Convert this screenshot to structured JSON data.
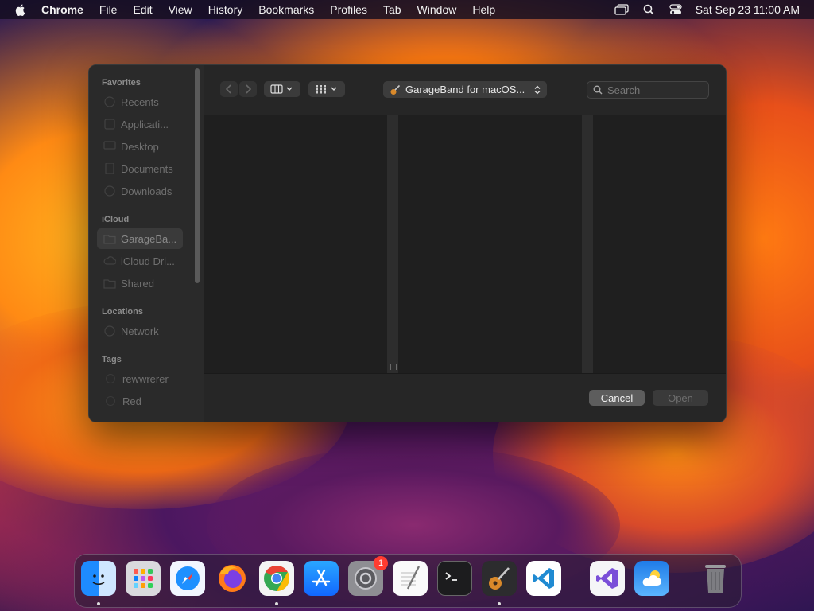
{
  "menubar": {
    "app_name": "Chrome",
    "items": [
      "File",
      "Edit",
      "View",
      "History",
      "Bookmarks",
      "Profiles",
      "Tab",
      "Window",
      "Help"
    ],
    "clock": "Sat Sep 23  11:00 AM",
    "status_icons": [
      "screen-mirroring-icon",
      "search-icon",
      "control-center-icon"
    ]
  },
  "dialog": {
    "sidebar": {
      "sections": [
        {
          "label": "Favorites",
          "items": [
            "Recents",
            "Applicati...",
            "Desktop",
            "Documents",
            "Downloads"
          ]
        },
        {
          "label": "iCloud",
          "items": [
            "GarageBa...",
            "iCloud Dri...",
            "Shared"
          ]
        },
        {
          "label": "Locations",
          "items": [
            "Network"
          ]
        },
        {
          "label": "Tags",
          "items": [
            "rewwrerer",
            "Red"
          ]
        }
      ],
      "selected": "GarageBa...",
      "tag_colors": {
        "rewwrerer": "#2a2a2a",
        "Red": "#2a2a2a"
      }
    },
    "toolbar": {
      "location": "GarageBand for macOS...",
      "search_placeholder": "Search"
    },
    "buttons": {
      "cancel": "Cancel",
      "open": "Open"
    }
  },
  "dock": {
    "apps": [
      "Finder",
      "Launchpad",
      "Safari",
      "Firefox",
      "Chrome",
      "App Store",
      "System Settings",
      "TextEdit",
      "Terminal",
      "GarageBand",
      "Visual Studio Code",
      "Visual Studio",
      "Weather",
      "Trash"
    ],
    "settings_badge": "1"
  }
}
